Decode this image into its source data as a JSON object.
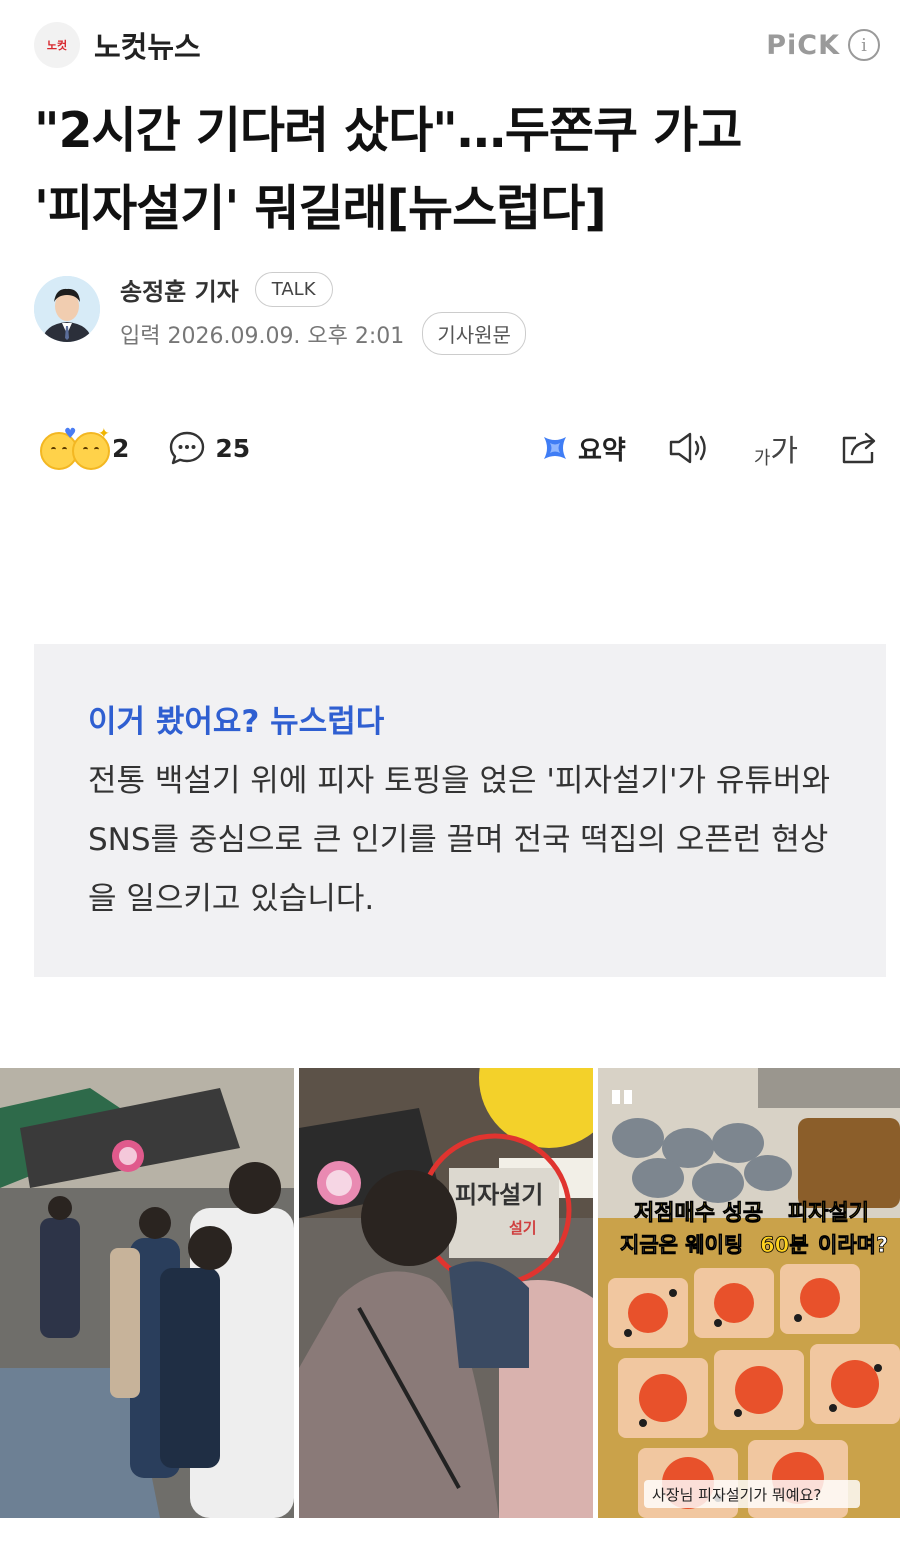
{
  "publisher": {
    "logo_text": "노컷",
    "name": "노컷뉴스",
    "pick_label": "PiCK",
    "info_icon": "info-icon"
  },
  "headline": {
    "line1": "\"2시간 기다려 샀다\"…두쫀쿠 가고",
    "line2": "'피자설기' 뭐길래[뉴스럽다]"
  },
  "byline": {
    "reporter": "송정훈 기자",
    "talk_label": "TALK",
    "date": "입력 2026.09.09. 오후 2:01",
    "original_label": "기사원문"
  },
  "actions": {
    "reaction_count": "2",
    "comment_count": "25",
    "summary_label": "요약",
    "font_small": "가",
    "font_big": "가"
  },
  "summary_box": {
    "title": "이거 봤어요? 뉴스럽다",
    "body": "전통 백설기 위에 피자 토핑을 얹은 '피자설기'가 유튜버와 SNS를 중심으로 큰 인기를 끌며 전국 떡집의 오픈런 현상을 일으키고 있습니다."
  },
  "photos": {
    "sign_big": "피자설기",
    "sign_small": "설기",
    "caption_line1_a": "저점매수 성공 ",
    "caption_line1_b": "피자설기",
    "caption_line2_a": "지금은 웨이팅 ",
    "caption_line2_b": "60분",
    "caption_line2_c": "이라며?",
    "bottom_caption": "사장님 피자설기가 뭐예요?"
  },
  "colors": {
    "accent_blue": "#2f5fd1",
    "box_bg": "#f1f1f3",
    "caption_yellow": "#ffd21f",
    "brand_red": "#d8262c"
  }
}
